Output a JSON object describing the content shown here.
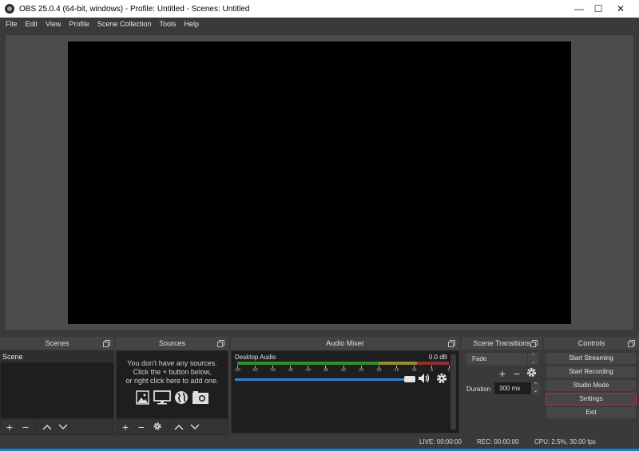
{
  "window": {
    "title": "OBS 25.0.4 (64-bit, windows) - Profile: Untitled - Scenes: Untitled",
    "app_icon": "obs-logo-icon",
    "controls": {
      "minimize": "—",
      "maximize": "☐",
      "close": "✕"
    }
  },
  "menu": {
    "items": [
      {
        "label": "File"
      },
      {
        "label": "Edit"
      },
      {
        "label": "View"
      },
      {
        "label": "Profile"
      },
      {
        "label": "Scene Collection"
      },
      {
        "label": "Tools"
      },
      {
        "label": "Help"
      }
    ]
  },
  "scenes": {
    "title": "Scenes",
    "items": [
      {
        "label": "Scene",
        "selected": true
      }
    ],
    "toolbar": {
      "add": "+",
      "remove": "−",
      "up": "∧",
      "down": "∨"
    }
  },
  "sources": {
    "title": "Sources",
    "empty_line1": "You don't have any sources.",
    "empty_line2": "Click the + button below,",
    "empty_line3": "or right click here to add one.",
    "empty_icons": [
      "image-icon",
      "display-icon",
      "globe-icon",
      "camera-icon"
    ],
    "toolbar": {
      "add": "+",
      "remove": "−",
      "up": "∧",
      "down": "∨"
    }
  },
  "audio_mixer": {
    "title": "Audio Mixer",
    "channels": [
      {
        "name": "Desktop Audio",
        "level": "0.0 dB",
        "volume_percent": 100,
        "scale_ticks": [
          "-60",
          "-55",
          "-50",
          "-45",
          "-40",
          "-35",
          "-30",
          "-25",
          "-20",
          "-15",
          "-10",
          "-5",
          "0"
        ],
        "zones": [
          {
            "name": "normal",
            "from_db": -60,
            "to_db": -20,
            "color": "#2f8f2f"
          },
          {
            "name": "warning",
            "from_db": -20,
            "to_db": -9,
            "color": "#8f8f2f"
          },
          {
            "name": "error",
            "from_db": -9,
            "to_db": 0,
            "color": "#8f2f2f"
          }
        ]
      }
    ]
  },
  "scene_transitions": {
    "title": "Scene Transitions",
    "selected_transition": "Fade",
    "toolbar": {
      "add": "+",
      "remove": "−"
    },
    "duration_label": "Duration",
    "duration_value": "300 ms"
  },
  "controls": {
    "title": "Controls",
    "buttons": [
      {
        "label": "Start Streaming"
      },
      {
        "label": "Start Recording"
      },
      {
        "label": "Studio Mode"
      },
      {
        "label": "Settings",
        "highlighted": true
      },
      {
        "label": "Exit"
      }
    ]
  },
  "status": {
    "live": "LIVE: 00:00:00",
    "rec": "REC: 00:00:00",
    "cpu": "CPU: 2.5%, 30.00 fps"
  },
  "colors": {
    "accent_volume": "#2f7fd6",
    "highlight_border": "#e0202a",
    "taskbar": "#1583c4"
  }
}
